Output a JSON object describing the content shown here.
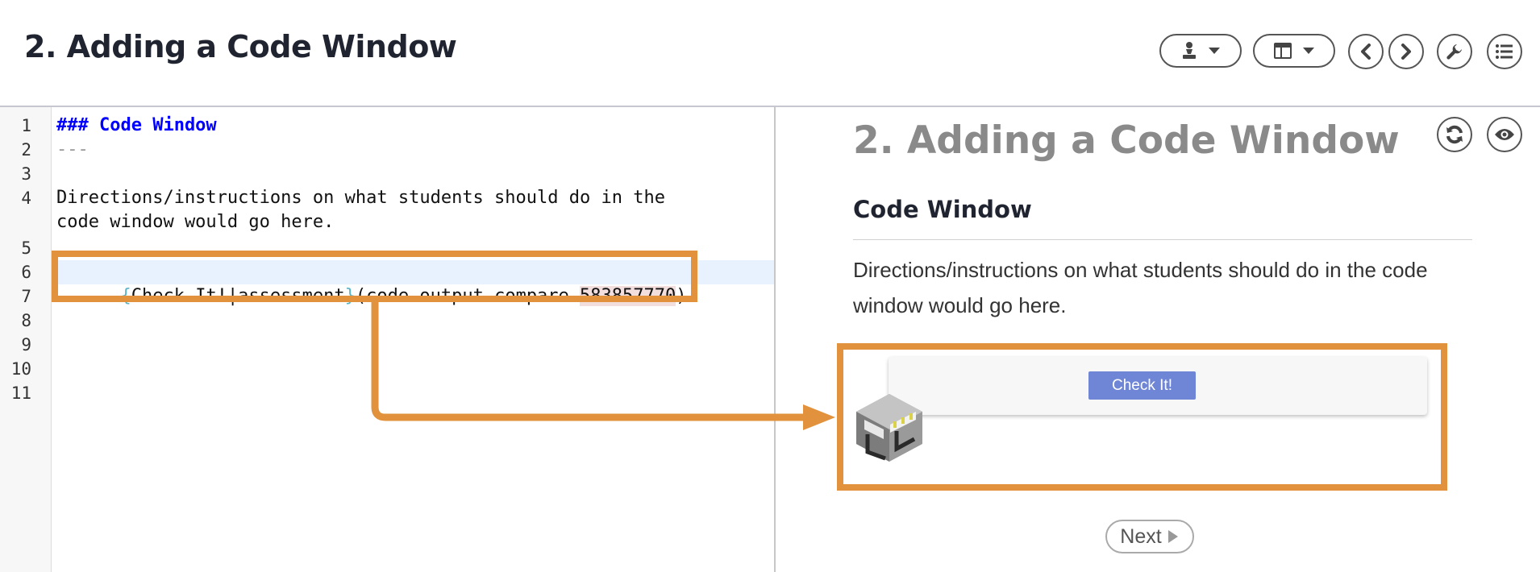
{
  "header": {
    "title": "2. Adding a Code Window"
  },
  "toolbar": {
    "icons": [
      "chess-pawn-icon",
      "layout-icon",
      "chevron-left-icon",
      "chevron-right-icon",
      "wrench-icon",
      "list-icon"
    ]
  },
  "editor": {
    "line_numbers": [
      "1",
      "2",
      "3",
      "4",
      "5",
      "6",
      "7",
      "8",
      "9",
      "10",
      "11"
    ],
    "lines": {
      "l1": "### Code Window",
      "l2": "---",
      "l4a": "Directions/instructions on what students should do in the",
      "l4b": "code window would go here.",
      "l6_open": "{",
      "l6_label": "Check It!|assessment",
      "l6_close": "}",
      "l6_target_prefix": "(code-output-compare-",
      "l6_target_id": "583857770",
      "l6_target_suffix": ")"
    }
  },
  "preview": {
    "title": "2. Adding a Code Window",
    "heading": "Code Window",
    "paragraph": "Directions/instructions on what students should do in the code window would go here.",
    "check_button": "Check It!",
    "next_button": "Next"
  },
  "colors": {
    "annotation": "#e2913c",
    "check_button": "#6f86d6",
    "md_header": "#0000ff",
    "active_line": "#e8f2ff"
  }
}
